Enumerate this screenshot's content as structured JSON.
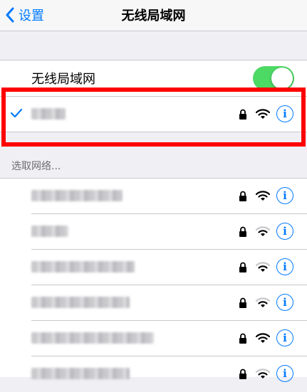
{
  "nav": {
    "back_label": "设置",
    "title": "无线局域网"
  },
  "wifi_toggle": {
    "label": "无线局域网",
    "state": "on",
    "color": "#4cd964"
  },
  "connected_network": {
    "secured": true,
    "signal": "full"
  },
  "section_header": "选取网络...",
  "networks": [
    {
      "secured": true,
      "signal": "full"
    },
    {
      "secured": true,
      "signal": "weak"
    },
    {
      "secured": true,
      "signal": "weak"
    },
    {
      "secured": true,
      "signal": "weak"
    },
    {
      "secured": true,
      "signal": "full"
    },
    {
      "secured": true,
      "signal": "weak"
    }
  ],
  "colors": {
    "accent": "#007aff",
    "highlight_box": "#ff0000",
    "background": "#efeff4"
  },
  "icons": [
    "chevron-left-icon",
    "checkmark-icon",
    "lock-icon",
    "wifi-icon",
    "info-icon"
  ]
}
